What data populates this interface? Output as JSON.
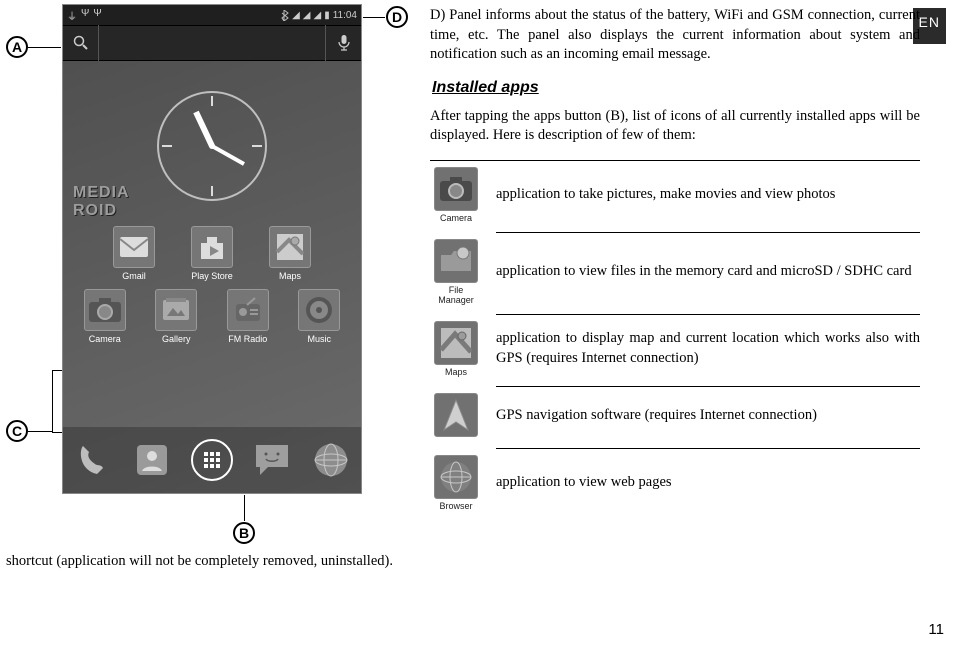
{
  "language_badge": "EN",
  "callouts": {
    "a": "A",
    "b": "B",
    "c": "C",
    "d": "D"
  },
  "phone": {
    "status_time": "11:04",
    "brand_line1": "MEDIA",
    "brand_line2": "ROID",
    "row1": [
      {
        "label": "Gmail"
      },
      {
        "label": "Play Store"
      },
      {
        "label": "Maps"
      }
    ],
    "row2": [
      {
        "label": "Camera"
      },
      {
        "label": "Gallery"
      },
      {
        "label": "FM Radio"
      },
      {
        "label": "Music"
      }
    ]
  },
  "text": {
    "panel_d": "D) Panel informs about the status of the battery, WiFi and GSM connection, current time, etc. The panel also displays the current information about system and notification such as an incoming email message.",
    "installed_apps_heading": "Installed apps",
    "installed_apps_body": "After tapping the apps button (B), list of icons of all currently installed apps will be displayed. Here is description of few of them:",
    "fragment": "shortcut (application will not be completely removed, uninstalled)."
  },
  "app_descriptions": [
    {
      "icon_label": "Camera",
      "desc": "application to take pictures, make movies and view photos"
    },
    {
      "icon_label": "File Manager",
      "desc": "application to view files in the memory card and microSD / SDHC card"
    },
    {
      "icon_label": "Maps",
      "desc": "application to display map and current location which works also with GPS (requires Internet connection)"
    },
    {
      "icon_label": "",
      "desc": "GPS navigation software (requires Internet connection)"
    },
    {
      "icon_label": "Browser",
      "desc": "application to view web pages"
    }
  ],
  "page_number": "11"
}
